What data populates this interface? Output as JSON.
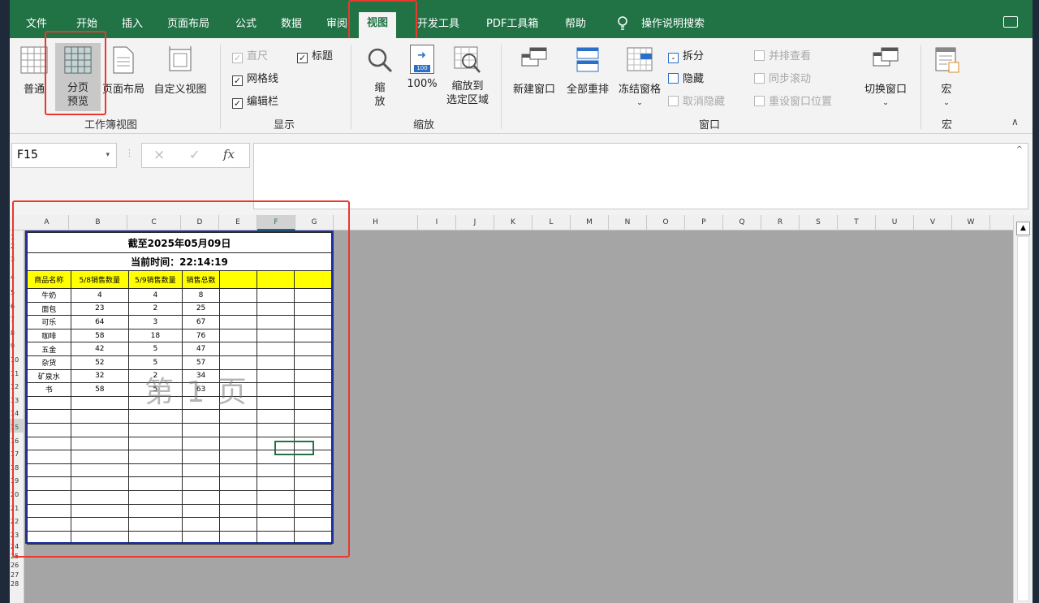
{
  "menu": {
    "tabs": [
      "文件",
      "开始",
      "插入",
      "页面布局",
      "公式",
      "数据",
      "审阅",
      "视图",
      "开发工具",
      "PDF工具箱",
      "帮助"
    ],
    "active_tab": "视图",
    "search_label": "操作说明搜索"
  },
  "ribbon": {
    "views": {
      "group_label": "工作簿视图",
      "normal": "普通",
      "page_break_1": "分页",
      "page_break_2": "预览",
      "page_layout": "页面布局",
      "custom_views": "自定义视图"
    },
    "show": {
      "group_label": "显示",
      "ruler": "直尺",
      "headings": "标题",
      "gridlines": "网格线",
      "formula_bar": "编辑栏"
    },
    "zoom": {
      "group_label": "缩放",
      "zoom_1": "缩",
      "zoom_2": "放",
      "hundred": "100%",
      "zoom_sel_1": "缩放到",
      "zoom_sel_2": "选定区域",
      "hundred_badge": "100"
    },
    "window": {
      "group_label": "窗口",
      "new_window": "新建窗口",
      "arrange_all": "全部重排",
      "freeze_panes": "冻结窗格",
      "split": "拆分",
      "hide": "隐藏",
      "unhide": "取消隐藏",
      "side_by_side": "并排查看",
      "sync_scroll": "同步滚动",
      "reset_position": "重设窗口位置",
      "switch_windows": "切换窗口"
    },
    "macros": {
      "group_label": "宏",
      "macros": "宏"
    }
  },
  "formula_bar": {
    "name_box": "F15",
    "fx": "fx",
    "cancel_glyph": "×",
    "enter_glyph": "✓"
  },
  "sheet": {
    "columns": [
      "A",
      "B",
      "C",
      "D",
      "E",
      "F",
      "G",
      "H",
      "I",
      "J",
      "K",
      "L",
      "M",
      "N",
      "O",
      "P",
      "Q",
      "R",
      "S",
      "T",
      "U",
      "V",
      "W"
    ],
    "selected_column": "F",
    "selected_row": "15",
    "row_numbers": [
      "1",
      "2",
      "3",
      "4",
      "5",
      "6",
      "7",
      "8",
      "9",
      "10",
      "11",
      "12",
      "13",
      "14",
      "15",
      "16",
      "17",
      "18",
      "19",
      "20",
      "21",
      "22",
      "23",
      "24",
      "25",
      "26",
      "27",
      "28"
    ],
    "title": "截至2025年05月09日",
    "time_line": "当前时间：22:14:19",
    "headers": [
      "商品名称",
      "5/8销售数量",
      "5/9销售数量",
      "销售总数"
    ],
    "rows": [
      [
        "牛奶",
        "4",
        "4",
        "8"
      ],
      [
        "面包",
        "23",
        "2",
        "25"
      ],
      [
        "可乐",
        "64",
        "3",
        "67"
      ],
      [
        "咖啡",
        "58",
        "18",
        "76"
      ],
      [
        "五金",
        "42",
        "5",
        "47"
      ],
      [
        "杂货",
        "52",
        "5",
        "57"
      ],
      [
        "矿泉水",
        "32",
        "2",
        "34"
      ],
      [
        "书",
        "58",
        "5",
        "63"
      ]
    ],
    "page_watermark": "第 1 页"
  },
  "colors": {
    "accent": "#217346",
    "highlight": "#e8392e",
    "header_fill": "#ffff00",
    "print_border": "#1f2fa0"
  }
}
